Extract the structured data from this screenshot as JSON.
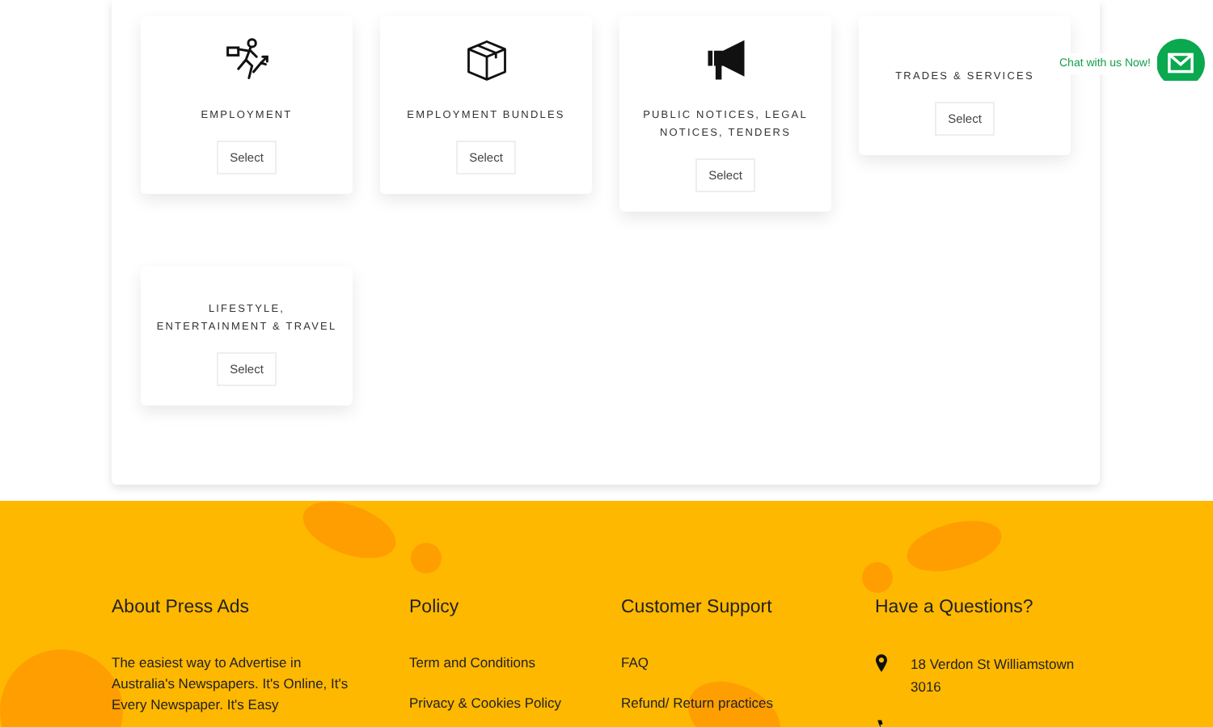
{
  "categories": [
    {
      "title": "EMPLOYMENT",
      "kind": "runner",
      "button": "Select"
    },
    {
      "title": "EMPLOYMENT BUNDLES",
      "kind": "box",
      "button": "Select"
    },
    {
      "title": "PUBLIC NOTICES, LEGAL NOTICES, TENDERS",
      "kind": "megaphone",
      "button": "Select"
    },
    {
      "title": "TRADES & SERVICES",
      "button": "Select"
    },
    {
      "title": "LIFESTYLE, ENTERTAINMENT & TRAVEL",
      "button": "Select"
    }
  ],
  "chat": {
    "label": "Chat with us Now!"
  },
  "footer": {
    "about": {
      "heading": "About Press Ads",
      "text": "The easiest way to Advertise in Australia's Newspapers. It's Online, It's Every Newspaper. It's Easy"
    },
    "policy": {
      "heading": "Policy",
      "links": [
        "Term and Conditions",
        "Privacy & Cookies Policy"
      ]
    },
    "support": {
      "heading": "Customer Support",
      "links": [
        "FAQ",
        "Refund/ Return practices"
      ]
    },
    "contact": {
      "heading": "Have a Questions?",
      "items": [
        {
          "kind": "address",
          "text": "18 Verdon St Williamstown 3016"
        },
        {
          "kind": "phone"
        }
      ]
    }
  }
}
